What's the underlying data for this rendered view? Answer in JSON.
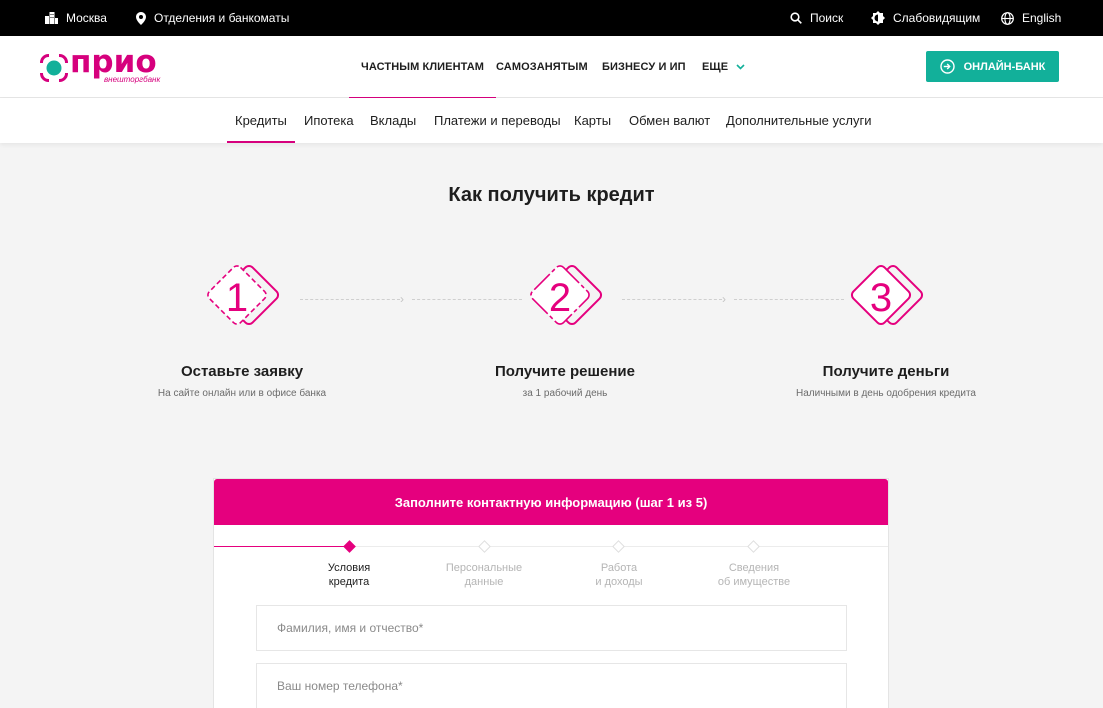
{
  "topbar": {
    "city": "Москва",
    "branches": "Отделения и банкоматы",
    "search": "Поиск",
    "accessibility": "Слабовидящим",
    "language": "English"
  },
  "header": {
    "logo_text": "прио",
    "logo_subtext": "внешторгбанк",
    "nav": [
      "ЧАСТНЫМ КЛИЕНТАМ",
      "САМОЗАНЯТЫМ",
      "БИЗНЕСУ И ИП",
      "ЕЩЕ"
    ],
    "online_bank": "ОНЛАЙН-БАНК"
  },
  "subnav": [
    "Кредиты",
    "Ипотека",
    "Вклады",
    "Платежи и переводы",
    "Карты",
    "Обмен валют",
    "Дополнительные услуги"
  ],
  "main": {
    "title": "Как получить кредит",
    "steps": [
      {
        "number": "1",
        "title": "Оставьте заявку",
        "desc": "На сайте онлайн или в офисе банка"
      },
      {
        "number": "2",
        "title": "Получите решение",
        "desc": "за 1 рабочий день"
      },
      {
        "number": "3",
        "title": "Получите деньги",
        "desc": "Наличными в день одобрения кредита"
      }
    ]
  },
  "form": {
    "header": "Заполните контактную информацию (шаг 1 из 5)",
    "progress": [
      {
        "line1": "Условия",
        "line2": "кредита"
      },
      {
        "line1": "Персональные",
        "line2": "данные"
      },
      {
        "line1": "Работа",
        "line2": "и доходы"
      },
      {
        "line1": "Сведения",
        "line2": "об имуществе"
      }
    ],
    "name_placeholder": "Фамилия, имя и отчество*",
    "phone_placeholder": "Ваш номер телефона*"
  },
  "colors": {
    "accent": "#d6007d",
    "teal": "#12b09a",
    "form_header": "#e5007e"
  }
}
